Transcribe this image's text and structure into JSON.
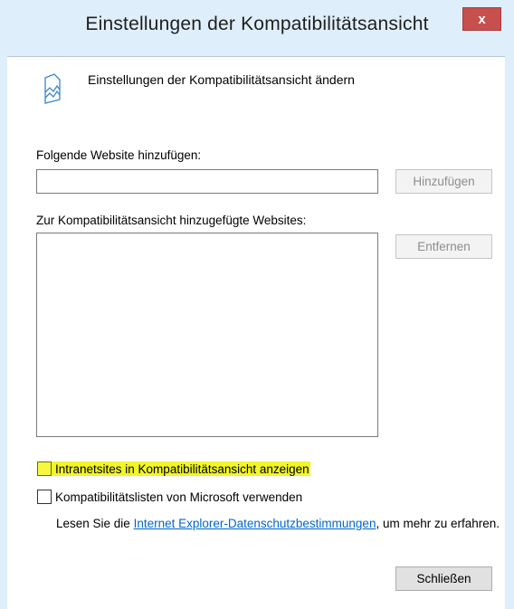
{
  "window": {
    "title": "Einstellungen der Kompatibilitätsansicht",
    "close_glyph": "x"
  },
  "header": {
    "icon": "compatibility-view-icon",
    "text": "Einstellungen der Kompatibilitätsansicht ändern"
  },
  "add_site": {
    "label": "Folgende Website hinzufügen:",
    "value": "",
    "placeholder": "",
    "button_label": "Hinzufügen"
  },
  "site_list": {
    "label": "Zur Kompatibilitätsansicht hinzugefügte Websites:",
    "items": [],
    "remove_button_label": "Entfernen"
  },
  "options": {
    "intranet": {
      "label": "Intranetsites in Kompatibilitätsansicht anzeigen",
      "checked": false,
      "highlight_color": "#f2f528"
    },
    "microsoft_lists": {
      "label": "Kompatibilitätslisten von Microsoft verwenden",
      "checked": false
    }
  },
  "privacy": {
    "prefix": "Lesen Sie die ",
    "link_text": "Internet Explorer-Datenschutzbestimmungen",
    "suffix": ", um mehr zu erfahren."
  },
  "close_button_label": "Schließen",
  "colors": {
    "titlebar": "#dfeefb",
    "close_button": "#c7504f",
    "link": "#0066cc"
  }
}
